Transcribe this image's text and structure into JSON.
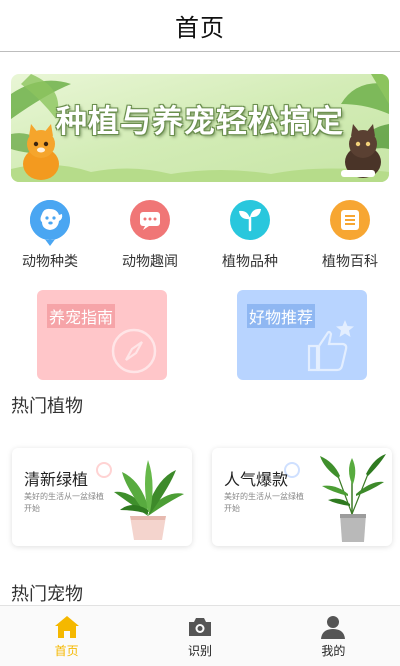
{
  "header": {
    "title": "首页"
  },
  "banner": {
    "text": "种植与养宠轻松搞定"
  },
  "categories": [
    {
      "label": "动物种类",
      "icon": "dog-icon",
      "color": "#4aa6f2"
    },
    {
      "label": "动物趣闻",
      "icon": "fun-news-icon",
      "color": "#f07676"
    },
    {
      "label": "植物品种",
      "icon": "sprout-icon",
      "color": "#29c7dd"
    },
    {
      "label": "植物百科",
      "icon": "book-icon",
      "color": "#f7a632"
    }
  ],
  "feature_cards": [
    {
      "label": "养宠指南",
      "icon": "compass-icon",
      "color": "#ffc6c9"
    },
    {
      "label": "好物推荐",
      "icon": "thumbs-up-icon",
      "color": "#b8d4ff"
    }
  ],
  "hot_plants": {
    "title": "热门植物",
    "items": [
      {
        "title": "清新绿植",
        "desc": "美好的生活从一盆绿植开始"
      },
      {
        "title": "人气爆款",
        "desc": "美好的生活从一盆绿植开始"
      }
    ]
  },
  "hot_pets": {
    "title": "热门宠物"
  },
  "tabbar": {
    "active_color": "#f5b800",
    "items": [
      {
        "label": "首页",
        "icon": "home-icon",
        "active": true
      },
      {
        "label": "识别",
        "icon": "camera-icon",
        "active": false
      },
      {
        "label": "我的",
        "icon": "user-icon",
        "active": false
      }
    ]
  }
}
